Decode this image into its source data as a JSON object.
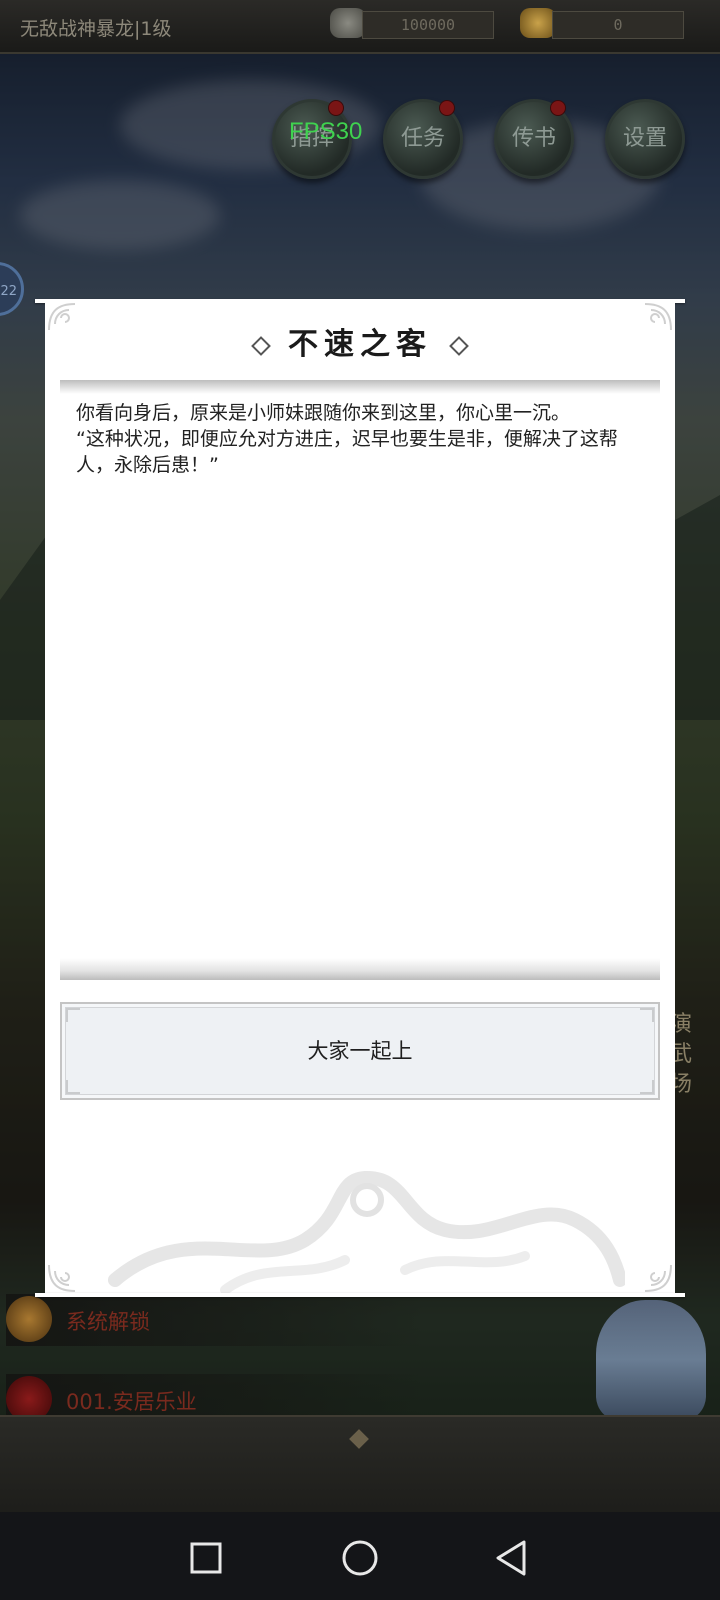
{
  "header": {
    "player": "无敌战神暴龙|1级",
    "silver": "100000",
    "gold": "0"
  },
  "top_buttons": [
    {
      "label": "指挥"
    },
    {
      "label": "任务"
    },
    {
      "label": "传书"
    },
    {
      "label": "设置"
    }
  ],
  "fps": "FPS30",
  "side_badge": "22",
  "quests": [
    {
      "label": "系统解锁",
      "color": "#7a2a1e"
    },
    {
      "label": "001.安居乐业",
      "color": "#7a2a1e"
    }
  ],
  "right_sign": "演武场",
  "dialog": {
    "title": "不速之客",
    "story": "你看向身后，原来是小师妹跟随你来到这里，你心里一沉。\n“这种状况，即便应允对方进庄，迟早也要生是非，便解决了这帮人，永除后患！”",
    "choice": "大家一起上"
  },
  "navbar": {
    "icons": [
      "recent-apps-icon",
      "home-icon",
      "back-icon"
    ]
  }
}
